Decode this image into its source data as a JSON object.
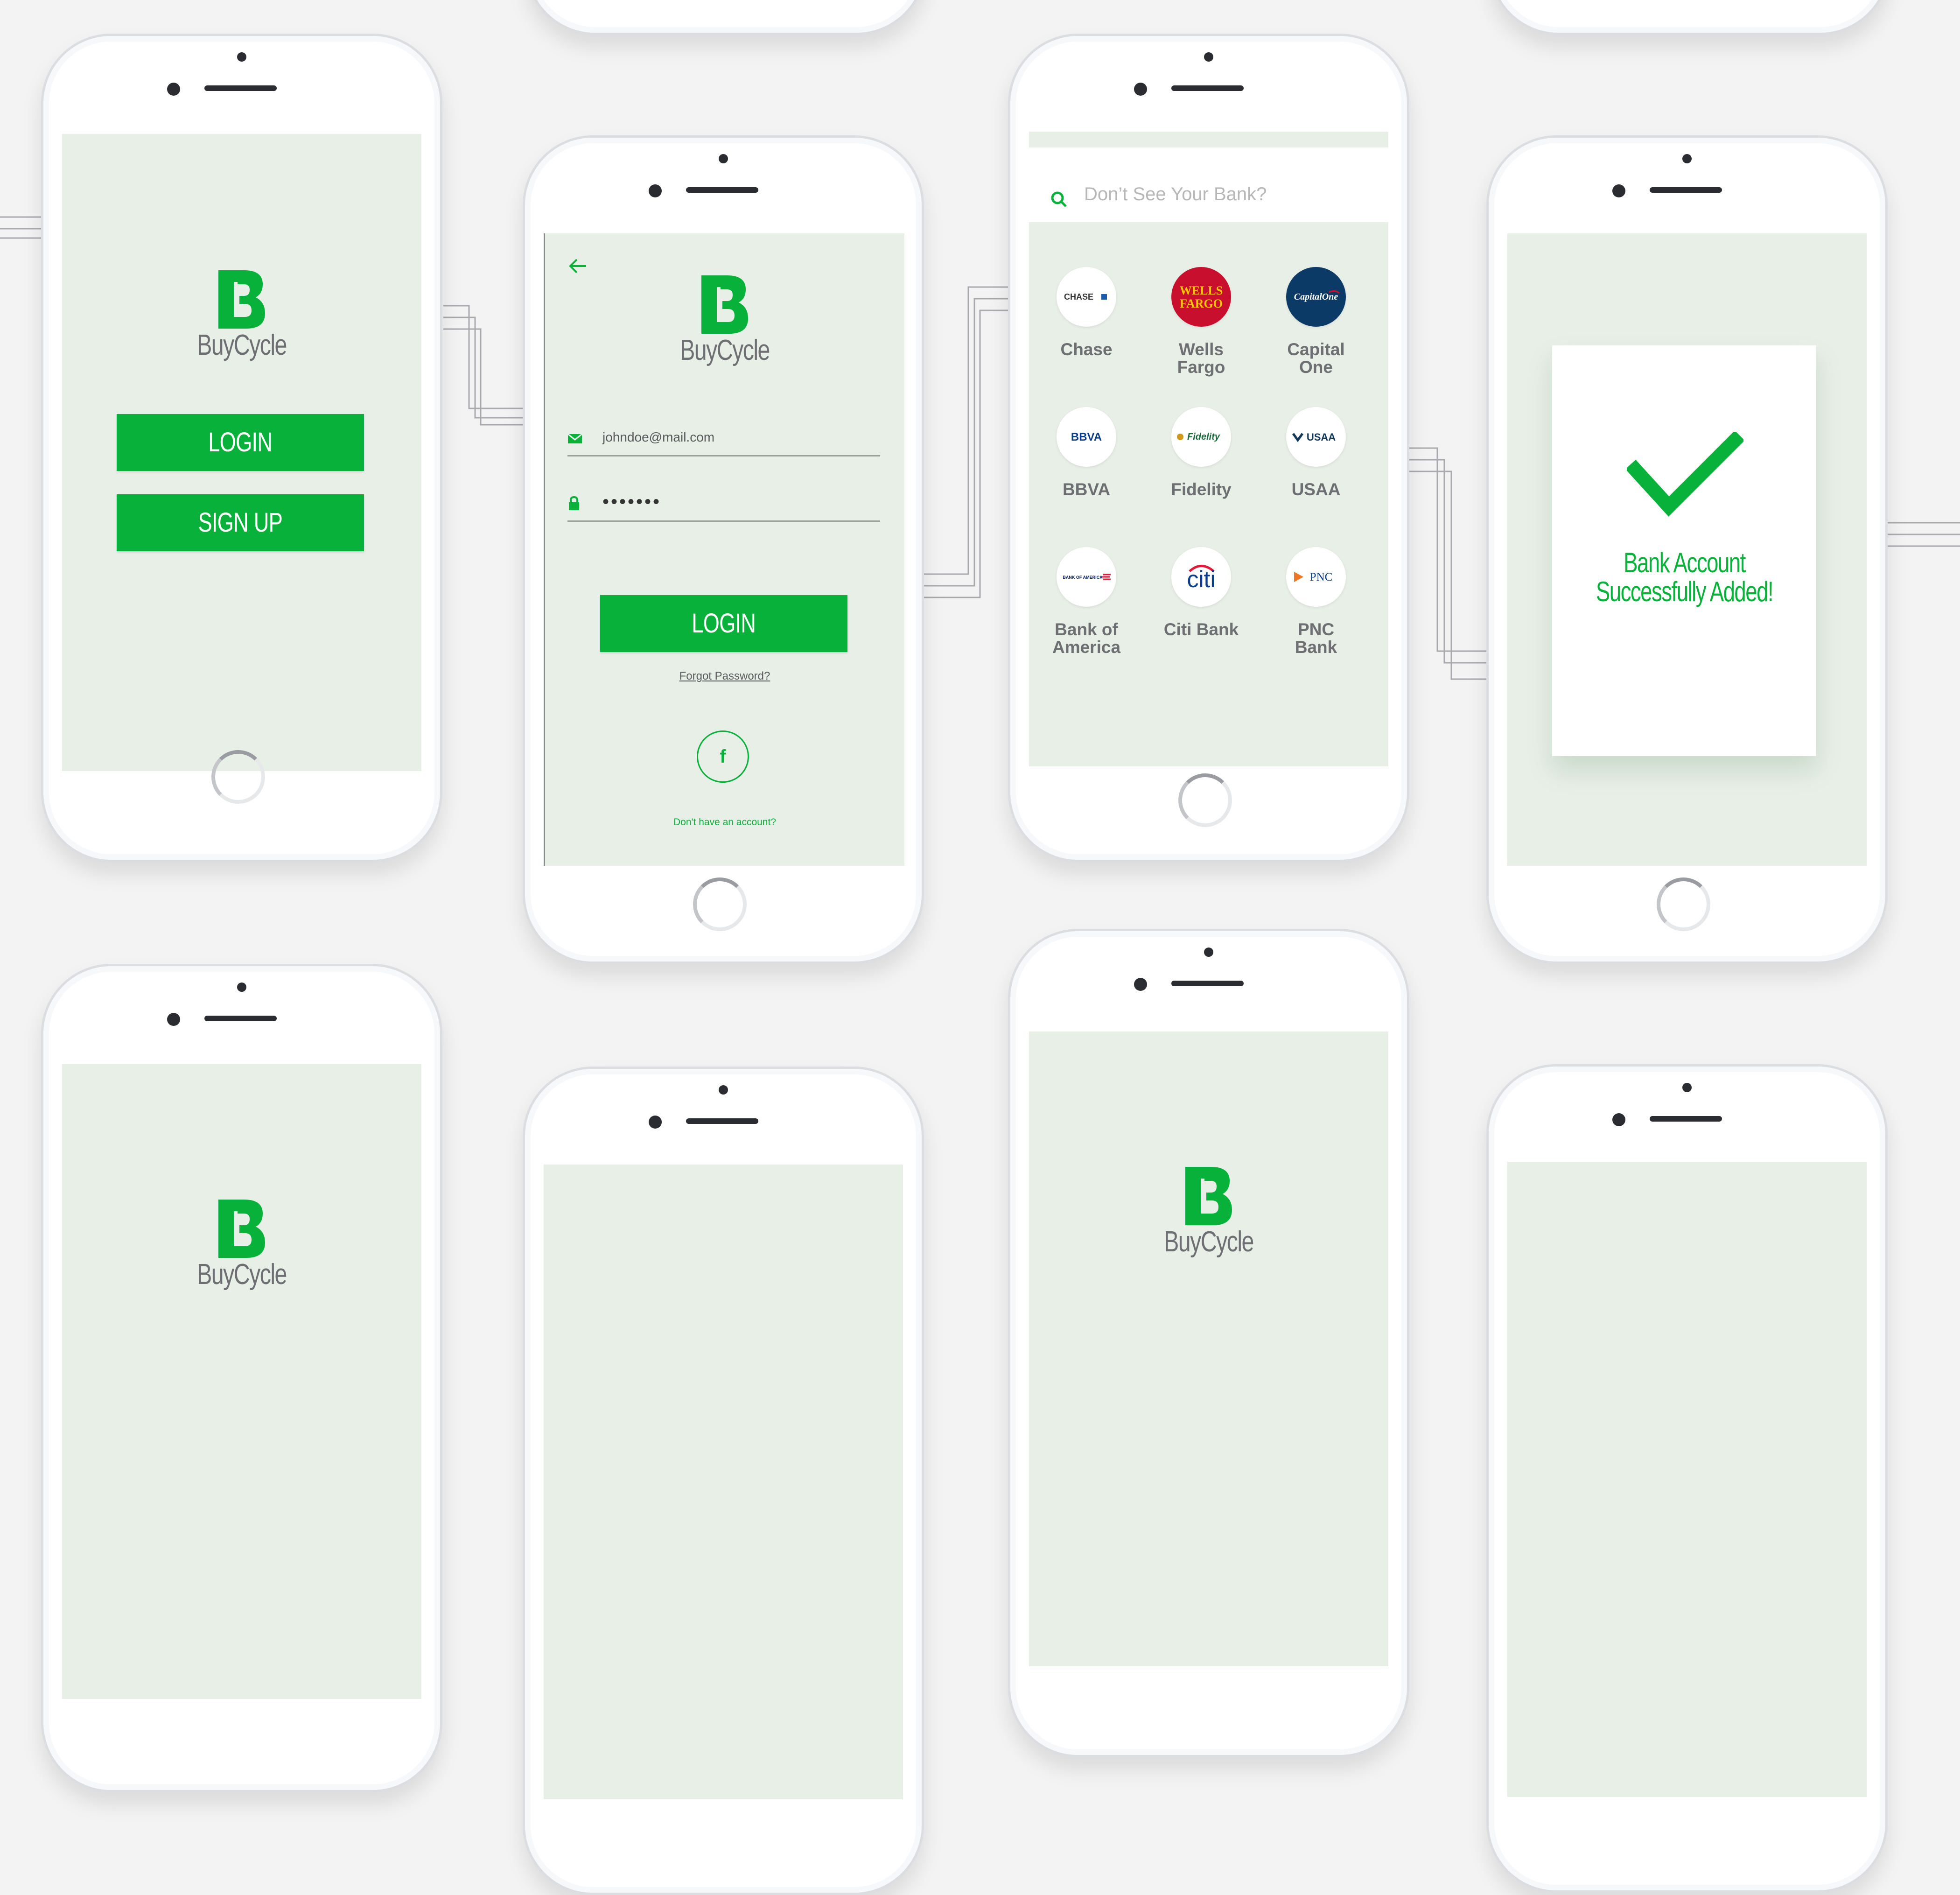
{
  "brand": {
    "name": "BuyCycle",
    "accent": "#08b23a",
    "screen_bg": "#e8efe7"
  },
  "welcome": {
    "login_label": "LOGIN",
    "signup_label": "SIGN UP"
  },
  "login": {
    "back_icon": "arrow-left-icon",
    "email_value": "johndoe@mail.com",
    "password_value": "•••••••",
    "login_label": "LOGIN",
    "forgot_label": "Forgot Password?",
    "facebook_icon": "f",
    "signup_prompt": "Don't have an account?"
  },
  "banks": {
    "search_placeholder": "Don’t See Your Bank?",
    "items": [
      {
        "name": "Chase",
        "logo": "CHASE"
      },
      {
        "name": "Wells Fargo",
        "logo": "WELLS FARGO"
      },
      {
        "name": "Capital One",
        "logo": "CapitalOne"
      },
      {
        "name": "BBVA",
        "logo": "BBVA"
      },
      {
        "name": "Fidelity",
        "logo": "Fidelity"
      },
      {
        "name": "USAA",
        "logo": "USAA"
      },
      {
        "name": "Bank of America",
        "logo": "BANK OF AMERICA"
      },
      {
        "name": "Citi Bank",
        "logo": "citi"
      },
      {
        "name": "PNC Bank",
        "logo": "PNC"
      }
    ]
  },
  "success": {
    "line1": "Bank Account",
    "line2": "Successfully Added!"
  }
}
